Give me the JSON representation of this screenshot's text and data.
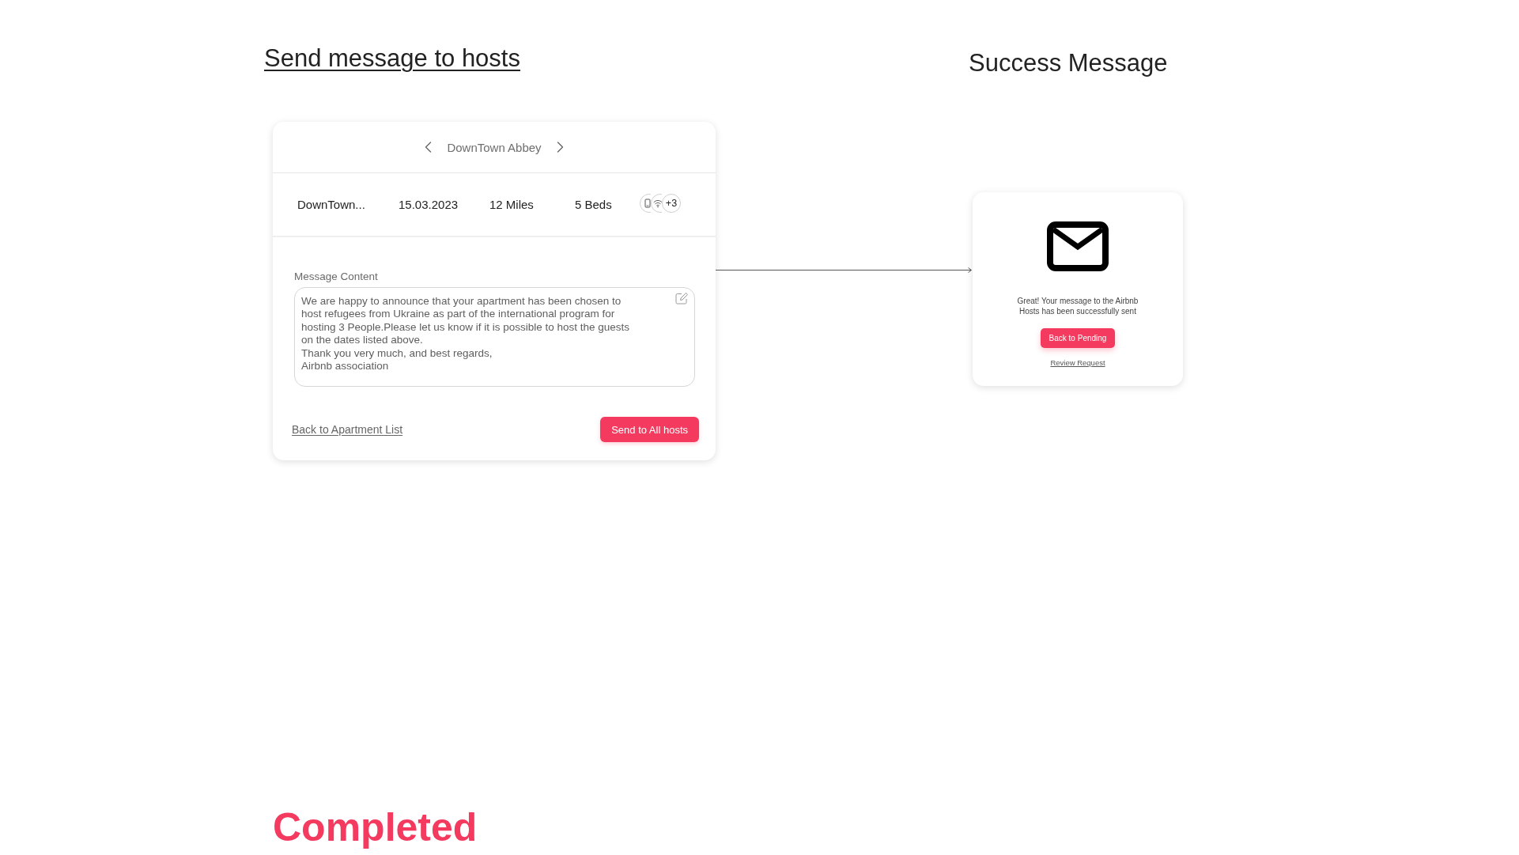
{
  "page_title": "Send message to hosts",
  "success_title": "Success Message",
  "message_card": {
    "apartment_switcher": {
      "label": "DownTown Abbey"
    },
    "apartment_row": {
      "name": "DownTown...",
      "date": "15.03.2023",
      "distance": "12 Miles",
      "beds": "5 Beds",
      "amenities_more": "+3"
    },
    "message": {
      "label": "Message Content",
      "value": "We are happy to announce that your apartment has been chosen to\nhost refugees from Ukraine as part of the international program for\nhosting 3 People.Please let us know if it is possible to host the guests\non the dates listed above.\nThank you very much, and best regards,\nAirbnb association"
    },
    "back_link": "Back to Apartment List",
    "send_button": "Send to All hosts"
  },
  "success_card": {
    "text": "Great! Your message to the Airbnb Hosts has been successfully sent",
    "primary_button": "Back to Pending",
    "link": "Review Request"
  },
  "status_label": "Completed"
}
